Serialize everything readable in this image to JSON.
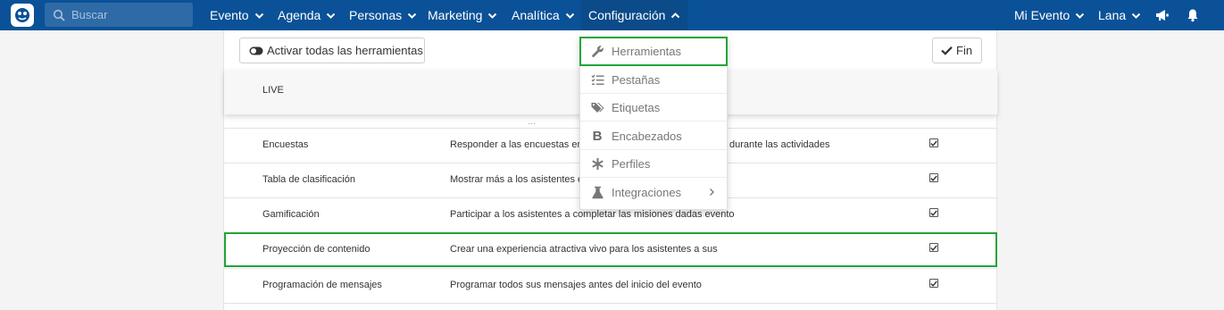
{
  "nav": {
    "search_placeholder": "Buscar",
    "items": [
      {
        "label": "Evento"
      },
      {
        "label": "Agenda"
      },
      {
        "label": "Personas"
      },
      {
        "label": "Marketing"
      },
      {
        "label": "Analítica"
      },
      {
        "label": "Configuración"
      }
    ],
    "right": {
      "event_label": "Mi Evento",
      "user_label": "Lana"
    }
  },
  "toolbar": {
    "activate_label": "Activar todas las herramientas",
    "done_label": "Fin"
  },
  "section": {
    "title": "LIVE",
    "behind_text": "..."
  },
  "rows": [
    {
      "name": "Encuestas",
      "desc": "Responder a las encuestas en v",
      "desc_tail": "durante las actividades",
      "checked": true
    },
    {
      "name": "Tabla de clasificación",
      "desc": "Mostrar más a los asistentes en",
      "checked": true
    },
    {
      "name": "Gamificación",
      "desc": "Participar a los asistentes a completar las misiones dadas evento",
      "checked": true
    },
    {
      "name": "Proyección de contenido",
      "desc": "Crear una experiencia atractiva vivo para los asistentes a sus",
      "checked": true
    },
    {
      "name": "Programación de mensajes",
      "desc": "Programar todos sus mensajes antes del inicio del evento",
      "checked": true
    }
  ],
  "dropdown": {
    "items": [
      {
        "label": "Herramientas",
        "icon": "wrench-icon"
      },
      {
        "label": "Pestañas",
        "icon": "checklist-icon"
      },
      {
        "label": "Etiquetas",
        "icon": "tags-icon"
      },
      {
        "label": "Encabezados",
        "icon": "bold-icon"
      },
      {
        "label": "Perfiles",
        "icon": "asterisk-icon"
      },
      {
        "label": "Integraciones",
        "icon": "flask-icon"
      }
    ]
  },
  "colors": {
    "nav": "#0a5197",
    "highlight": "#21a536",
    "card": "#ffffff",
    "page": "#f4f4f4"
  }
}
